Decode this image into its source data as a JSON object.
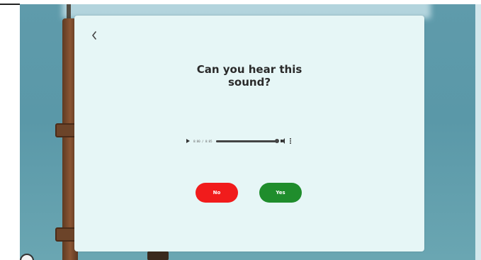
{
  "dialog": {
    "back_icon": "chevron-left-icon",
    "title_line1": "Can you hear this",
    "title_line2": "sound?"
  },
  "audio_player": {
    "time": "0:00 / 0:05",
    "progress": 1.0,
    "icons": [
      "play-icon",
      "volume-icon",
      "more-options-icon"
    ]
  },
  "buttons": {
    "no_label": "No",
    "yes_label": "Yes"
  },
  "colors": {
    "card_bg": "#e6f6f6",
    "no_button": "#f11c1c",
    "yes_button": "#1f8d2c",
    "background": "#5f9bab"
  }
}
